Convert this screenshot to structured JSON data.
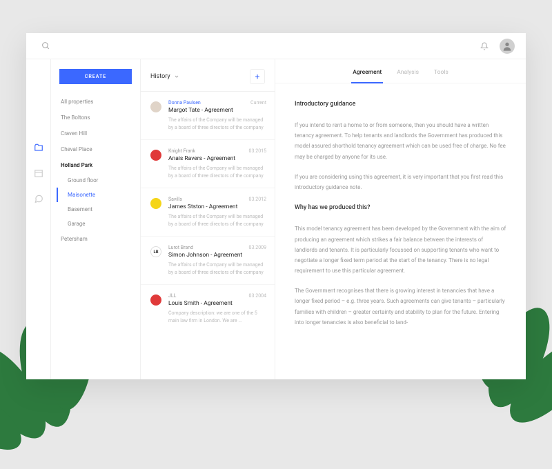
{
  "topbar": {},
  "sidebar": {
    "create_label": "CREATE",
    "items": [
      {
        "label": "All properties"
      },
      {
        "label": "The Boltons"
      },
      {
        "label": "Craven Hill"
      },
      {
        "label": "Cheval Place"
      },
      {
        "label": "Holland Park",
        "expanded": true,
        "children": [
          {
            "label": "Ground floor"
          },
          {
            "label": "Maisonette",
            "active": true
          },
          {
            "label": "Basement"
          },
          {
            "label": "Garage"
          }
        ]
      },
      {
        "label": "Petersham"
      }
    ]
  },
  "history": {
    "title": "History",
    "items": [
      {
        "company": "Donna Paulsen",
        "highlight": true,
        "date": "Current",
        "title": "Margot Tate - Agreement",
        "desc": "The affairs of the Company will be managed by a board of three directors of the company",
        "logo_bg": "#e0d4c8",
        "logo_text": ""
      },
      {
        "company": "Knight Frank",
        "date": "03.2015",
        "title": "Anais Ravers - Agreement",
        "desc": "The affairs of the Company will be managed by a board of three directors of the company",
        "logo_bg": "#e03a3a",
        "logo_text": ""
      },
      {
        "company": "Savills",
        "date": "03.2012",
        "title": "James Stston - Agreement",
        "desc": "The affairs of the Company will be managed by a board of three directors of the company",
        "logo_bg": "#f5d518",
        "logo_text": ""
      },
      {
        "company": "Lurot Brand",
        "date": "03.2009",
        "title": "Simon Johnson - Agreement",
        "desc": "The affairs of the Company will be managed by a board of three directors of the company",
        "logo_bg": "#ffffff",
        "logo_text": "LB"
      },
      {
        "company": "JLL",
        "date": "03.2004",
        "title": "Louis Smith - Agreement",
        "desc": "Company description: we are one of the 5 main law firm in London. We are ...",
        "logo_bg": "#e03a3a",
        "logo_text": ""
      }
    ]
  },
  "content": {
    "tabs": [
      {
        "label": "Agreement",
        "active": true
      },
      {
        "label": "Analysis"
      },
      {
        "label": "Tools"
      }
    ],
    "heading1": "Introductory guidance",
    "para1": "If you intend to rent a home to or from someone, then you should have a written tenancy agreement. To help tenants and landlords the Government has produced this model assured shorthold tenancy agreement which can be used free of charge. No fee may be charged by anyone for its use.",
    "para2": "If you are considering using this agreement, it is very important that you first read this introductory guidance note.",
    "heading2": "Why has we produced this?",
    "para3": "This model tenancy agreement has been developed by the Government with the aim of producing an agreement which strikes a fair balance between the interests of landlords and tenants. It is particularly focussed on supporting tenants who want to negotiate a longer fixed term period at the start of the tenancy. There is no legal requirement to use this particular agreement.",
    "para4": "The Government recognises that there is growing interest in tenancies that have a longer fixed period – e.g. three years. Such agreements can give tenants – particularly families with children – greater certainty and stability to plan for the future. Entering into longer tenancies is also beneficial to land-"
  }
}
